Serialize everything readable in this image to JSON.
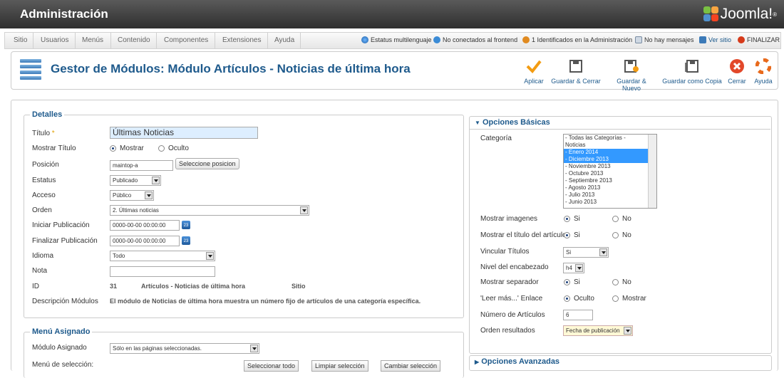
{
  "app": {
    "title": "Administración",
    "logo_text": "Joomla!",
    "logo_mark": "®"
  },
  "menu": [
    "Sitio",
    "Usuarios",
    "Menús",
    "Contenido",
    "Componentes",
    "Extensiones",
    "Ayuda"
  ],
  "status": {
    "multilang": "Estatus multilenguaje",
    "frontend": "No conectados al frontend",
    "admin": "1 Identificados en la Administración",
    "messages": "No hay mensajes",
    "view_site": "Ver sitio",
    "logout": "FINALIZAR"
  },
  "toolbar": {
    "page_title": "Gestor de Módulos: Módulo Artículos - Noticias de última hora",
    "buttons": [
      "Aplicar",
      "Guardar & Cerrar",
      "Guardar & Nuevo",
      "Guardar como Copia",
      "Cerrar",
      "Ayuda"
    ]
  },
  "details": {
    "legend": "Detalles",
    "titulo_label": "Título",
    "required_mark": "*",
    "titulo_value": "Últimas Noticias",
    "mostrar_titulo_label": "Mostrar Título",
    "mostrar": "Mostrar",
    "oculto": "Oculto",
    "posicion_label": "Posición",
    "posicion_value": "maintop-a",
    "posicion_button": "Seleccione posicion",
    "estatus_label": "Estatus",
    "estatus_value": "Publicado",
    "acceso_label": "Acceso",
    "acceso_value": "Público",
    "orden_label": "Orden",
    "orden_value": "2. Últimas noticias",
    "iniciar_label": "Iniciar Publicación",
    "iniciar_value": "0000-00-00 00:00:00",
    "finalizar_label": "Finalizar Publicación",
    "finalizar_value": "0000-00-00 00:00:00",
    "calendar_day": "23",
    "idioma_label": "Idioma",
    "idioma_value": "Todo",
    "nota_label": "Nota",
    "nota_value": "",
    "id_label": "ID",
    "id_value": "31",
    "id_type": "Artículos - Noticias de última hora",
    "id_client": "Sitio",
    "desc_label": "Descripción Módulos",
    "desc_value": "El módulo de Noticias de última hora muestra un número fijo de artículos de una categoría específica."
  },
  "menu_assign": {
    "legend": "Menú Asignado",
    "modulo_label": "Módulo Asignado",
    "modulo_value": "Sólo en las páginas seleccionadas.",
    "seleccion_label": "Menú de selección:",
    "btn_select_all": "Seleccionar todo",
    "btn_clear": "Limpiar selección",
    "btn_change": "Cambiar selección"
  },
  "basic": {
    "header": "Opciones Básicas",
    "categoria_label": "Categoría",
    "categories": [
      {
        "text": "- Todas las Categorías -",
        "selected": false
      },
      {
        "text": "Noticias",
        "selected": false
      },
      {
        "text": "- Enero 2014",
        "selected": true
      },
      {
        "text": "- Diciembre 2013",
        "selected": true
      },
      {
        "text": "- Noviembre 2013",
        "selected": false
      },
      {
        "text": "- Octubre 2013",
        "selected": false
      },
      {
        "text": "- Septiembre 2013",
        "selected": false
      },
      {
        "text": "- Agosto 2013",
        "selected": false
      },
      {
        "text": "- Julio 2013",
        "selected": false
      },
      {
        "text": "- Junio 2013",
        "selected": false
      }
    ],
    "mostrar_imagenes_label": "Mostrar imagenes",
    "mostrar_titulo_label": "Mostrar el título del artículo",
    "si": "Si",
    "no": "No",
    "vincular_label": "Vincular Títulos",
    "vincular_value": "Si",
    "nivel_label": "Nivel del encabezado",
    "nivel_value": "h4",
    "separador_label": "Mostrar separador",
    "leer_label": "'Leer más...' Enlace",
    "oculto": "Oculto",
    "mostrar": "Mostrar",
    "numero_label": "Número de Artículos",
    "numero_value": "6",
    "orden_label": "Orden resultados",
    "orden_value": "Fecha de publicación"
  },
  "advanced": {
    "header": "Opciones Avanzadas"
  }
}
